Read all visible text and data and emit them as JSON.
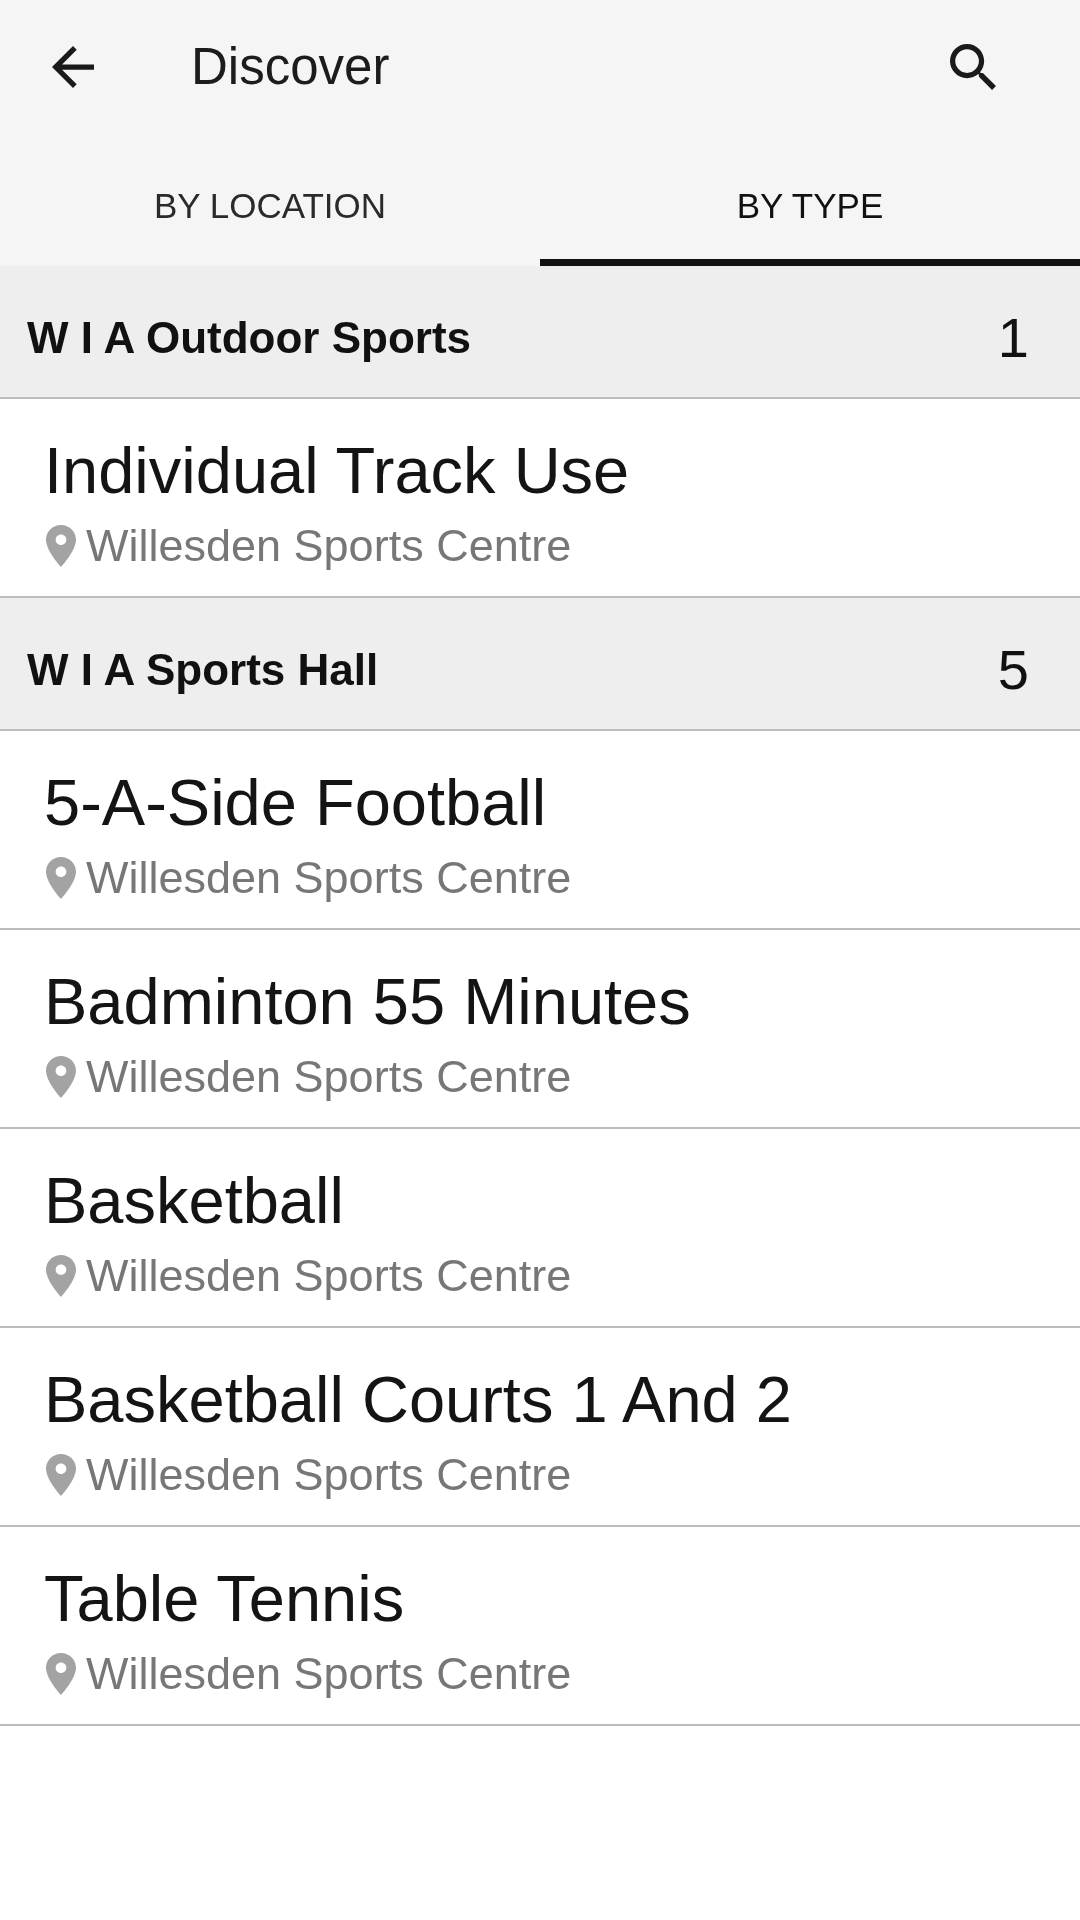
{
  "app_bar": {
    "title": "Discover"
  },
  "tabs": [
    {
      "label": "BY LOCATION",
      "selected": false
    },
    {
      "label": "BY TYPE",
      "selected": true
    }
  ],
  "sections": [
    {
      "title": "W I A Outdoor Sports",
      "count": "1",
      "items": [
        {
          "name": "Individual Track Use",
          "location": "Willesden Sports Centre"
        }
      ]
    },
    {
      "title": "W I A Sports Hall",
      "count": "5",
      "items": [
        {
          "name": "5-A-Side Football",
          "location": "Willesden Sports Centre"
        },
        {
          "name": "Badminton 55 Minutes",
          "location": "Willesden Sports Centre"
        },
        {
          "name": "Basketball",
          "location": "Willesden Sports Centre"
        },
        {
          "name": "Basketball Courts 1 And 2",
          "location": "Willesden Sports Centre"
        },
        {
          "name": "Table Tennis",
          "location": "Willesden Sports Centre"
        }
      ]
    }
  ]
}
